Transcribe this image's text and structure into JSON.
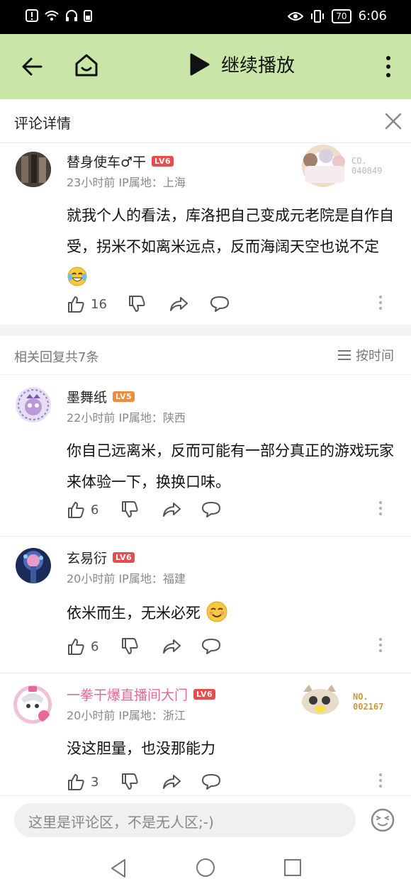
{
  "status_bar": {
    "time": "6:06",
    "battery": "70"
  },
  "toolbar": {
    "play_label": "继续播放"
  },
  "panel": {
    "title": "评论详情"
  },
  "main_comment": {
    "username": "替身使车♂干",
    "level": "LV6",
    "badge_number": "CO.\n040849",
    "meta": "23小时前 IP属地：上海",
    "body": "就我个人的看法，库洛把自己变成元老院是自作自受，拐米不如离米远点，反而海阔天空也说不定",
    "likes": "16"
  },
  "replies_header": {
    "count_label": "相关回复共7条",
    "sort_label": "按时间"
  },
  "replies": [
    {
      "username": "墨舞纸",
      "level": "LV5",
      "meta": "22小时前 IP属地：陕西",
      "body": "你自己远离米，反而可能有一部分真正的游戏玩家来体验一下，换换口味。",
      "likes": "6"
    },
    {
      "username": "玄易衍",
      "level": "LV6",
      "meta": "20小时前 IP属地：福建",
      "body": "依米而生，无米必死",
      "likes": "6"
    },
    {
      "username": "一拳干爆直播间大门",
      "level": "LV6",
      "badge_number": "NO.\n002167",
      "meta": "20小时前 IP属地：浙江",
      "body": "没这胆量，也没那能力",
      "likes": "3"
    }
  ],
  "input": {
    "placeholder": "这里是评论区，不是无人区;-)"
  },
  "colors": {
    "topbar_bg": "#c9e6a8",
    "level_red": "#e84d4d",
    "level_orange": "#f08c3a",
    "vip_name": "#e8679b"
  }
}
